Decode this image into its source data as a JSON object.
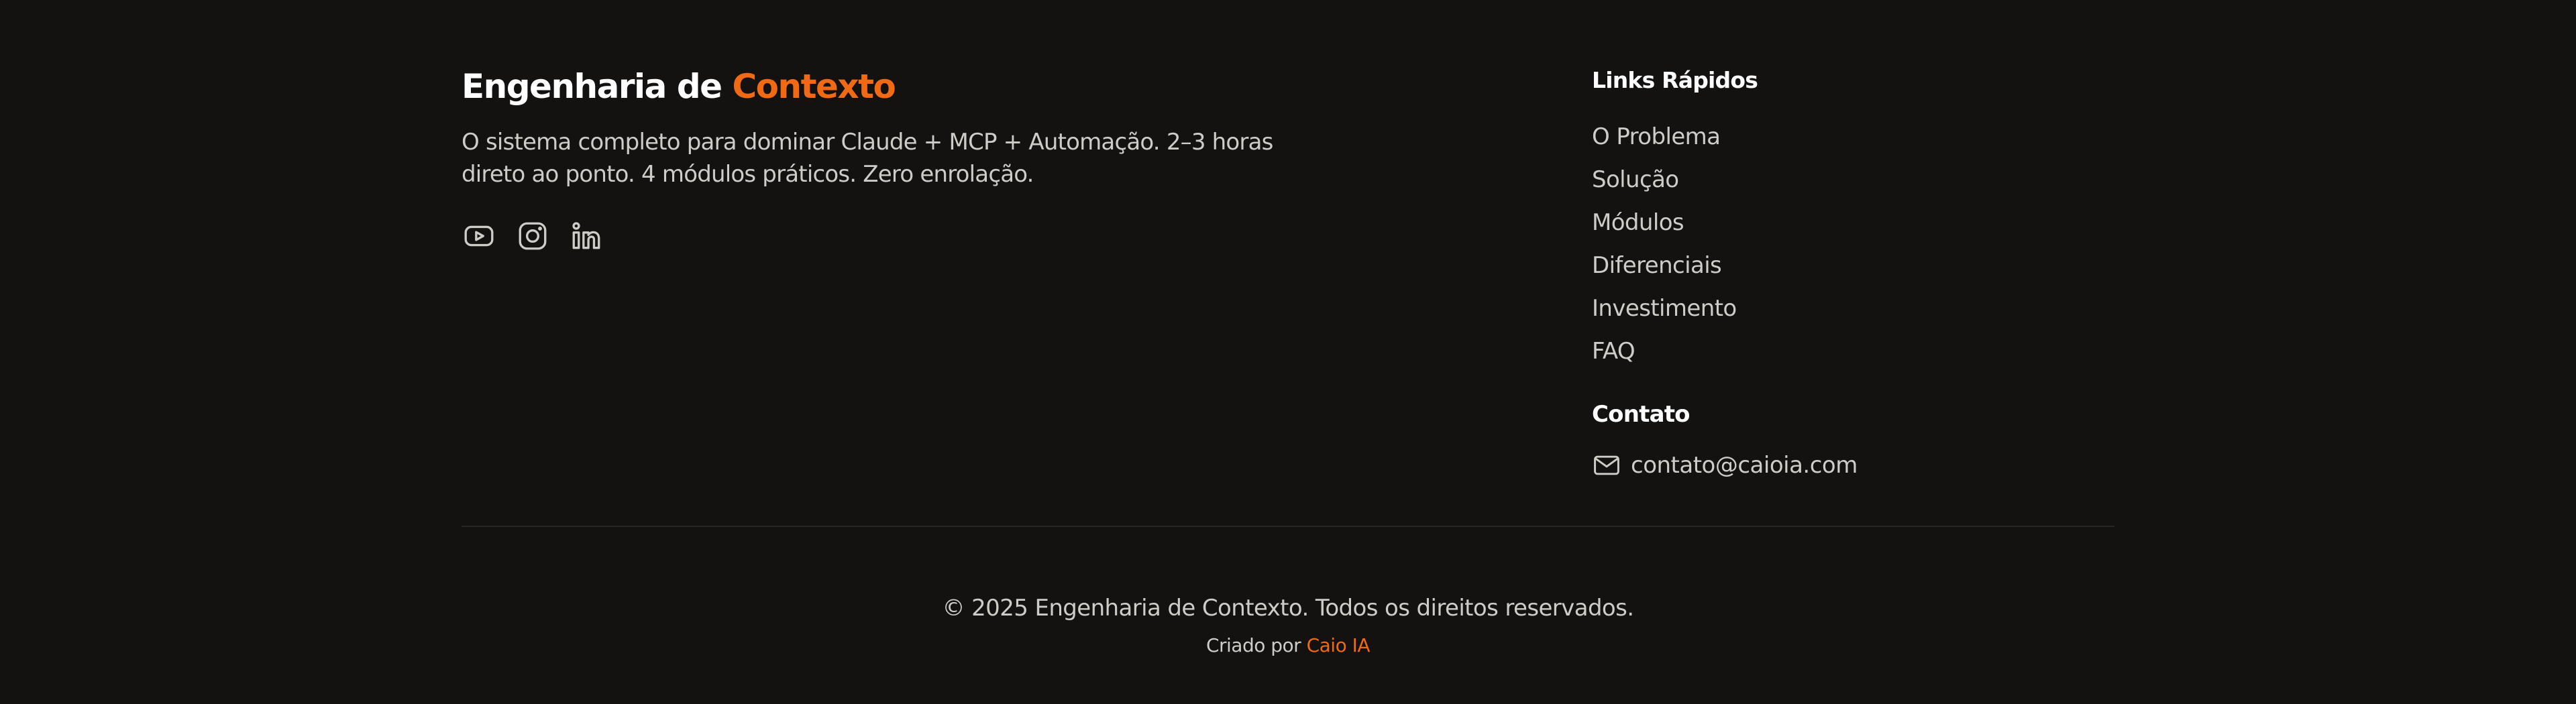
{
  "brand": {
    "title_part1": "Engenharia de ",
    "title_part2": "Contexto",
    "description": "O sistema completo para dominar Claude + MCP + Automação. 2–3 horas direto ao ponto. 4 módulos práticos. Zero enrolação.",
    "socials": [
      {
        "icon": "youtube-icon"
      },
      {
        "icon": "instagram-icon"
      },
      {
        "icon": "linkedin-icon"
      }
    ]
  },
  "quick_links": {
    "title": "Links Rápidos",
    "items": [
      "O Problema",
      "Solução",
      "Módulos",
      "Diferenciais",
      "Investimento",
      "FAQ"
    ]
  },
  "contact": {
    "title": "Contato",
    "icon": "mail-icon",
    "email": "contato@caioia.com"
  },
  "footer": {
    "copyright": "© 2025 Engenharia de Contexto. Todos os direitos reservados.",
    "credit_prefix": "Criado por ",
    "credit_name": "Caio IA"
  },
  "colors": {
    "background": "#131211",
    "accent": "#f06a16",
    "heading": "#ffffff",
    "text": "#cfccc8",
    "divider": "#2a2826"
  }
}
